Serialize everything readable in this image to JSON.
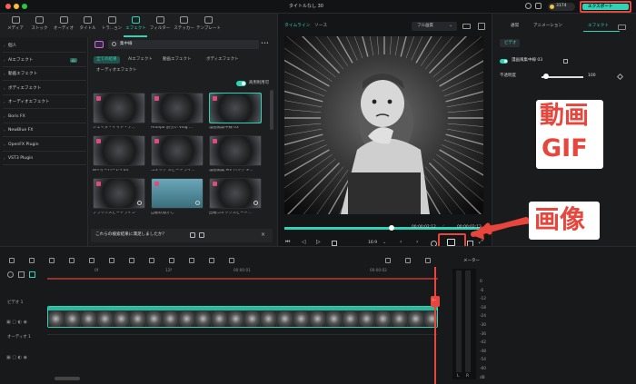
{
  "titlebar": {
    "title": "タイトルなし 30",
    "credits": "3174",
    "export_label": "エクスポート"
  },
  "tools": [
    {
      "label": "メディア",
      "icon": "media-icon"
    },
    {
      "label": "ストック",
      "icon": "stock-icon"
    },
    {
      "label": "オーディオ",
      "icon": "audio-icon"
    },
    {
      "label": "タイトル",
      "icon": "title-icon"
    },
    {
      "label": "トラ...ョン",
      "icon": "transition-icon"
    },
    {
      "label": "エフェクト",
      "icon": "effect-icon"
    },
    {
      "label": "フィルター",
      "icon": "filter-icon"
    },
    {
      "label": "ステッカー",
      "icon": "sticker-icon"
    },
    {
      "label": "テンプレート",
      "icon": "template-icon"
    }
  ],
  "sidebar": {
    "items": [
      {
        "label": "個人"
      },
      {
        "label": "AIエフェクト",
        "badge": "AI"
      },
      {
        "label": "動画エフェクト"
      },
      {
        "label": "ボディエフェクト"
      },
      {
        "label": "オーディオエフェクト"
      },
      {
        "label": "Boris FX"
      },
      {
        "label": "NewBlue FX"
      },
      {
        "label": "OpenFX Plugin"
      },
      {
        "label": "VST3 Plugin"
      }
    ]
  },
  "effects": {
    "search_value": "集中線",
    "chips": [
      "全ての結果",
      "AIエフェクト",
      "動画エフェクト",
      "ボディエフェクト",
      "オーディオエフェクト"
    ],
    "commercial_label": "商用利用可",
    "thumbs": [
      {
        "label": "ジェイタ・イマト・ア..."
      },
      {
        "label": "Anthpo 割引い Vlog ..."
      },
      {
        "label": "漫画風集中線 03"
      },
      {
        "label": "BFFオーバーレイ04"
      },
      {
        "label": "コミック スピードライ..."
      },
      {
        "label": "漫画風集 MV パック #..."
      },
      {
        "label": "ブラックスピードライン"
      },
      {
        "label": "自動状態かし"
      },
      {
        "label": "回転コミックスピード..."
      }
    ],
    "feedback": "これらの検索結果に満足しましたか？"
  },
  "player": {
    "tab_timeline": "タイムライン",
    "tab_source": "ソース",
    "quality": "フル画質",
    "time_current": "00:00:02:12",
    "time_total": "00:00:02:12",
    "ratio": "16:9",
    "progress": 0.98
  },
  "inspector": {
    "tabs": [
      "通常",
      "アニメーション",
      "エフェクト"
    ],
    "subtab": "ビデオ",
    "effect_name": "漫画風集中線 03",
    "opacity_label": "不透明度",
    "opacity_value": "100",
    "reset_label": "リセット"
  },
  "timeline": {
    "ruler": [
      "0f",
      "12f",
      "00:00:01",
      "00:00:02"
    ],
    "meter_label": "メーター",
    "db_scale": [
      "0",
      "-6",
      "-12",
      "-18",
      "-24",
      "-30",
      "-36",
      "-42",
      "-48",
      "-54",
      "-60",
      "dB"
    ],
    "lr": [
      "L",
      "R"
    ],
    "video_track": "ビデオ 1",
    "audio_track": "オーディオ 1"
  },
  "annotations": {
    "gif": "動画\nGIF",
    "gif_line1": "動画",
    "gif_line2": "GIF",
    "image": "画像"
  },
  "colors": {
    "accent": "#2fd3b5",
    "annotation": "#e8453c",
    "heart": "#e14b7a"
  }
}
